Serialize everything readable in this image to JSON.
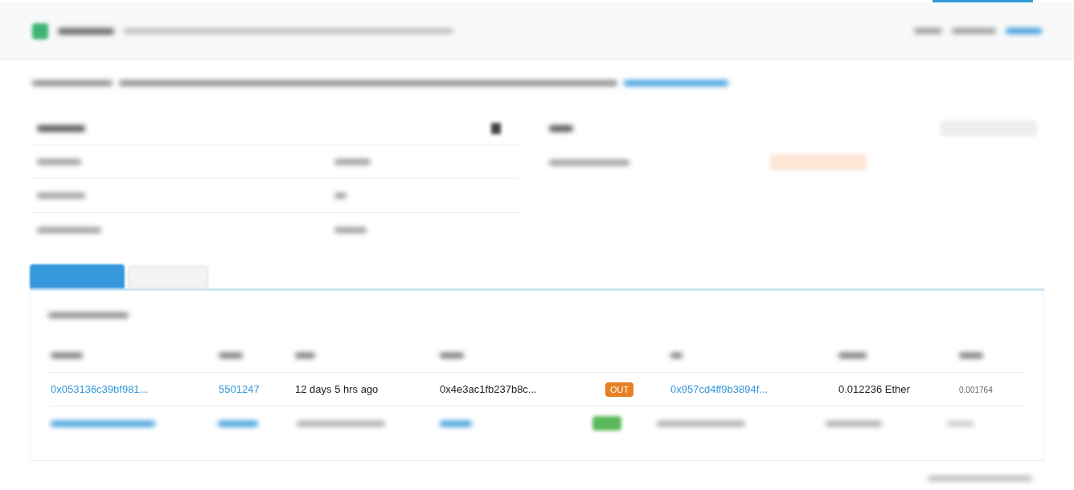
{
  "transactions": {
    "rows": [
      {
        "txhash": "0x053136c39bf981...",
        "block": "5501247",
        "age": "12 days 5 hrs ago",
        "from": "0x4e3ac1fb237b8c...",
        "direction": {
          "kind": "out",
          "label": "OUT"
        },
        "to": "0x957cd4ff9b3894f...",
        "value": "0.012236 Ether",
        "fee": "0.001764"
      }
    ]
  }
}
